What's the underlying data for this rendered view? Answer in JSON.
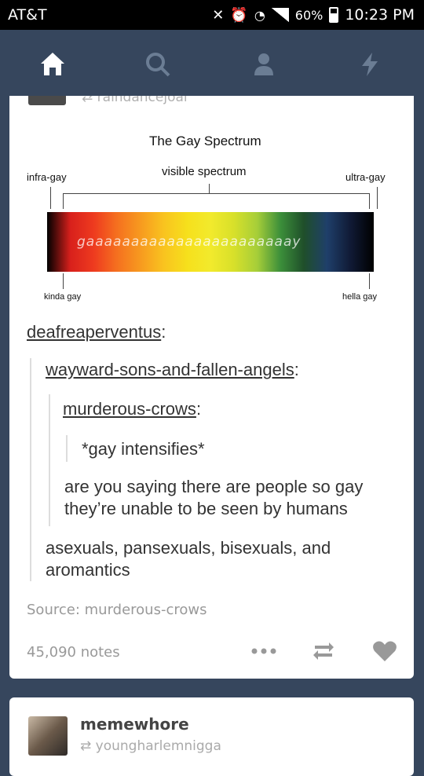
{
  "status_bar": {
    "carrier": "AT&T",
    "battery": "60%",
    "time": "10:23 PM"
  },
  "nav": {
    "icons": [
      "home-icon",
      "search-icon",
      "account-icon",
      "activity-icon"
    ]
  },
  "post": {
    "prev_reblog_name": "raindancejoal",
    "image": {
      "title": "The Gay Spectrum",
      "visible_label": "visible spectrum",
      "left_label": "infra-gay",
      "right_label": "ultra-gay",
      "bottom_left_label": "kinda gay",
      "bottom_right_label": "hella gay",
      "bar_text": "gaaaaaaaaaaaaaaaaaaaaaaay",
      "colors": [
        "#000000",
        "#d8201c",
        "#ee3b1f",
        "#f5701f",
        "#f79a1f",
        "#f9c31f",
        "#f6e01c",
        "#f2ea2c",
        "#d8e02a",
        "#a6ce39",
        "#3c8f3a",
        "#1f4f2a",
        "#1f3f6a",
        "#101a35",
        "#000000"
      ]
    },
    "users": {
      "u1": "deafreaperventus",
      "u2": "wayward-sons-and-fallen-angels",
      "u3": "murderous-crows"
    },
    "texts": {
      "t1": "*gay intensifies*",
      "t2": "are you saying there are people so gay",
      "t2b": "they’re unable to be seen by humans",
      "t3": "asexuals, pansexuals, bisexuals, and",
      "t3b": "aromantics"
    },
    "source_label": "Source:",
    "source_name": "murderous-crows",
    "notes": "45,090 notes",
    "actions": [
      "more-icon",
      "reblog-icon",
      "like-icon"
    ]
  },
  "next_post": {
    "blog_name": "memewhore",
    "reblogged_from": "youngharlemnigga"
  }
}
